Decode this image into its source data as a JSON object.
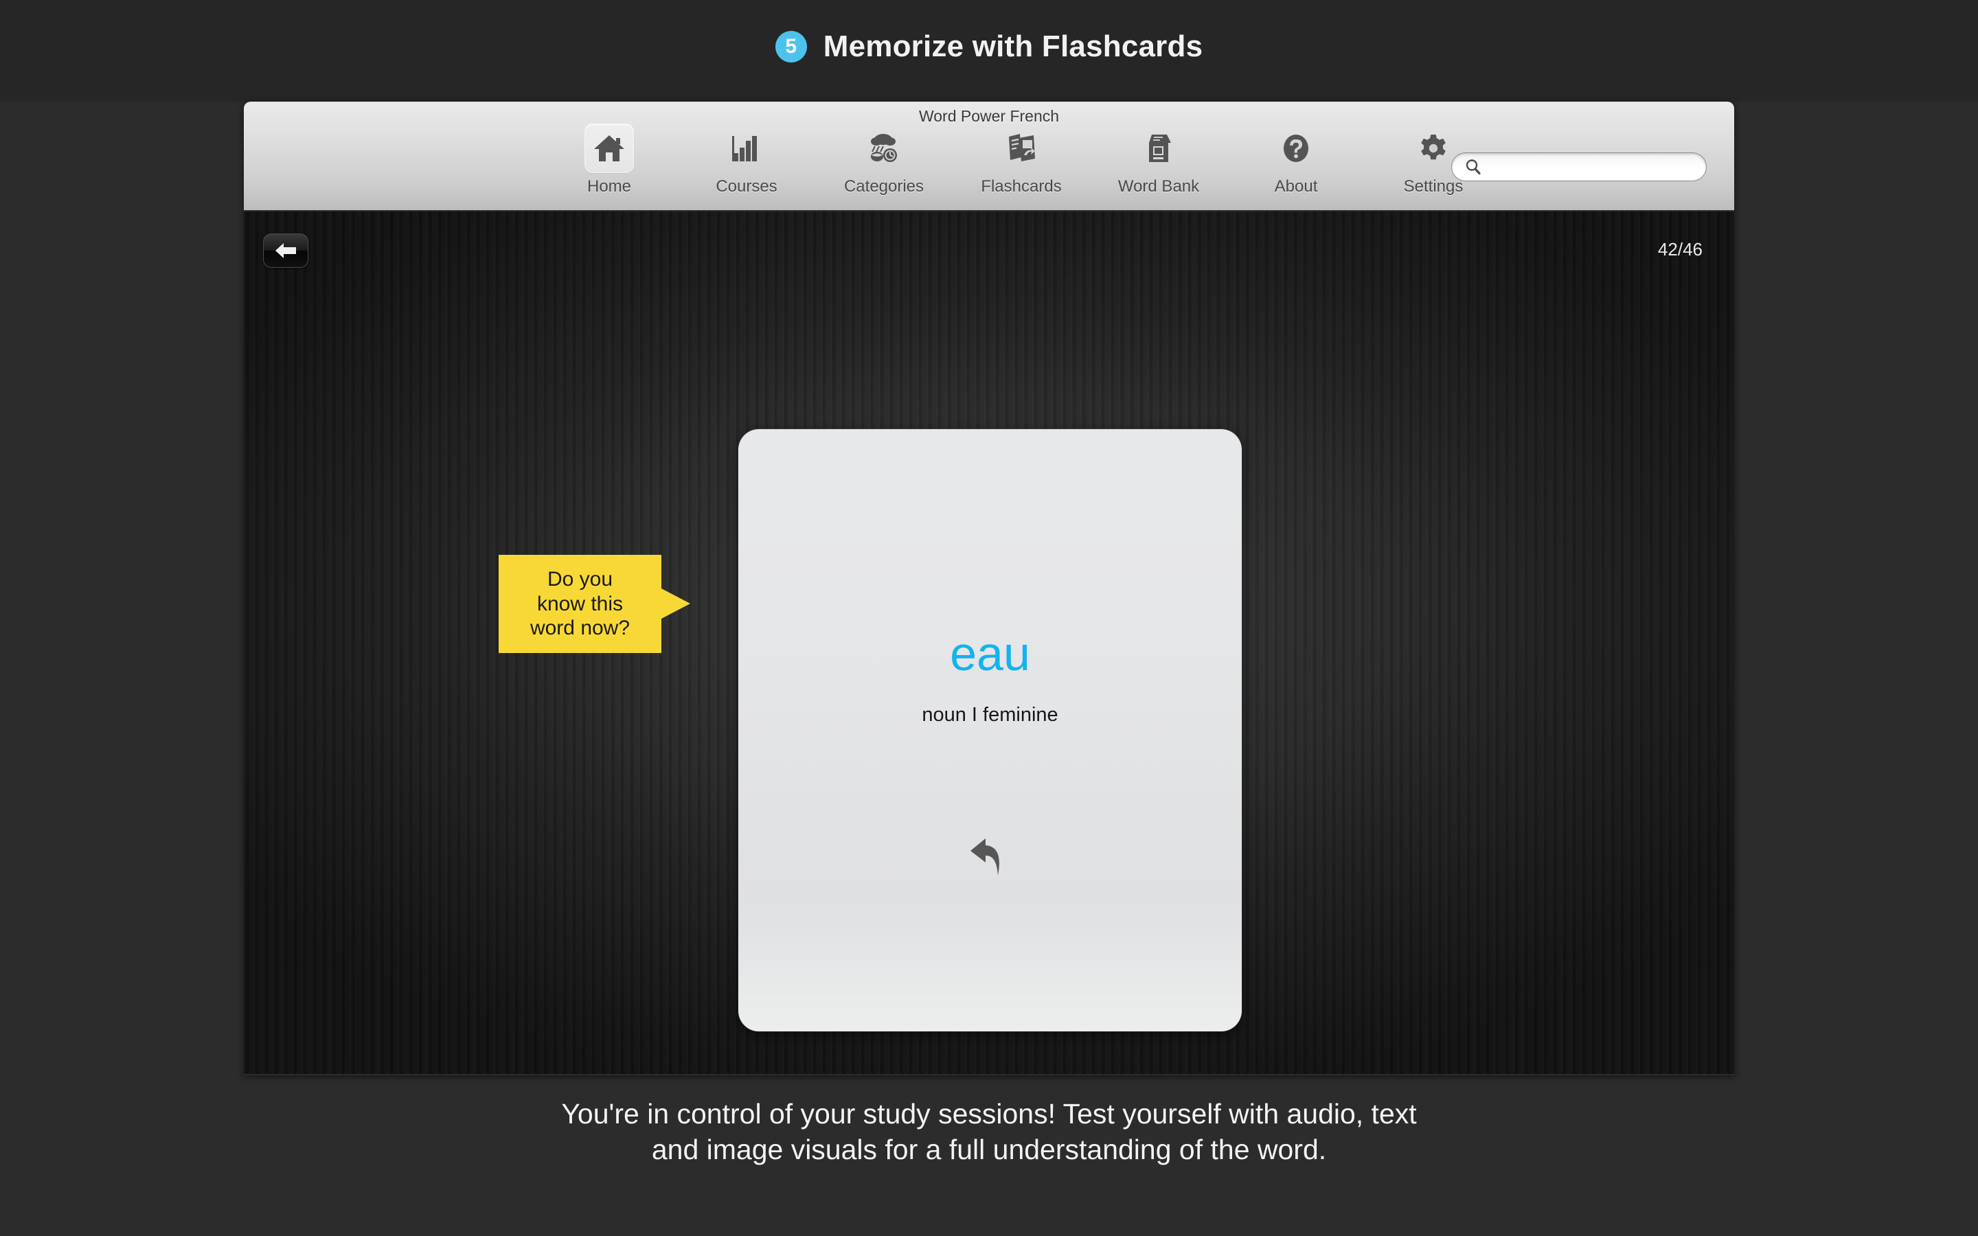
{
  "banner": {
    "step_number": "5",
    "title": "Memorize with Flashcards",
    "badge_color": "#4cc3ea"
  },
  "window": {
    "title": "Word Power French",
    "toolbar": {
      "items": [
        {
          "label": "Home",
          "icon": "home-icon",
          "selected": true
        },
        {
          "label": "Courses",
          "icon": "bar-chart-icon",
          "selected": false
        },
        {
          "label": "Categories",
          "icon": "categories-icon",
          "selected": false
        },
        {
          "label": "Flashcards",
          "icon": "flashcards-icon",
          "selected": false
        },
        {
          "label": "Word Bank",
          "icon": "word-bank-icon",
          "selected": false
        },
        {
          "label": "About",
          "icon": "question-mark-icon",
          "selected": false
        },
        {
          "label": "Settings",
          "icon": "gear-icon",
          "selected": false
        }
      ],
      "search": {
        "value": "",
        "placeholder": "",
        "icon": "search-icon"
      }
    }
  },
  "content": {
    "back_button": {
      "icon": "arrow-left-icon"
    },
    "counter": "42/46",
    "flashcard": {
      "word": "eau",
      "part_of_speech": "noun I feminine",
      "word_color": "#13b3ef",
      "flip_icon": "flip-back-arrow-icon"
    },
    "callout": {
      "text": "Do you\nknow this\nword now?",
      "color": "#f7d836"
    }
  },
  "caption": {
    "text": "You're in control of your study sessions! Test yourself with audio, text\nand image visuals for a full understanding of the word."
  }
}
